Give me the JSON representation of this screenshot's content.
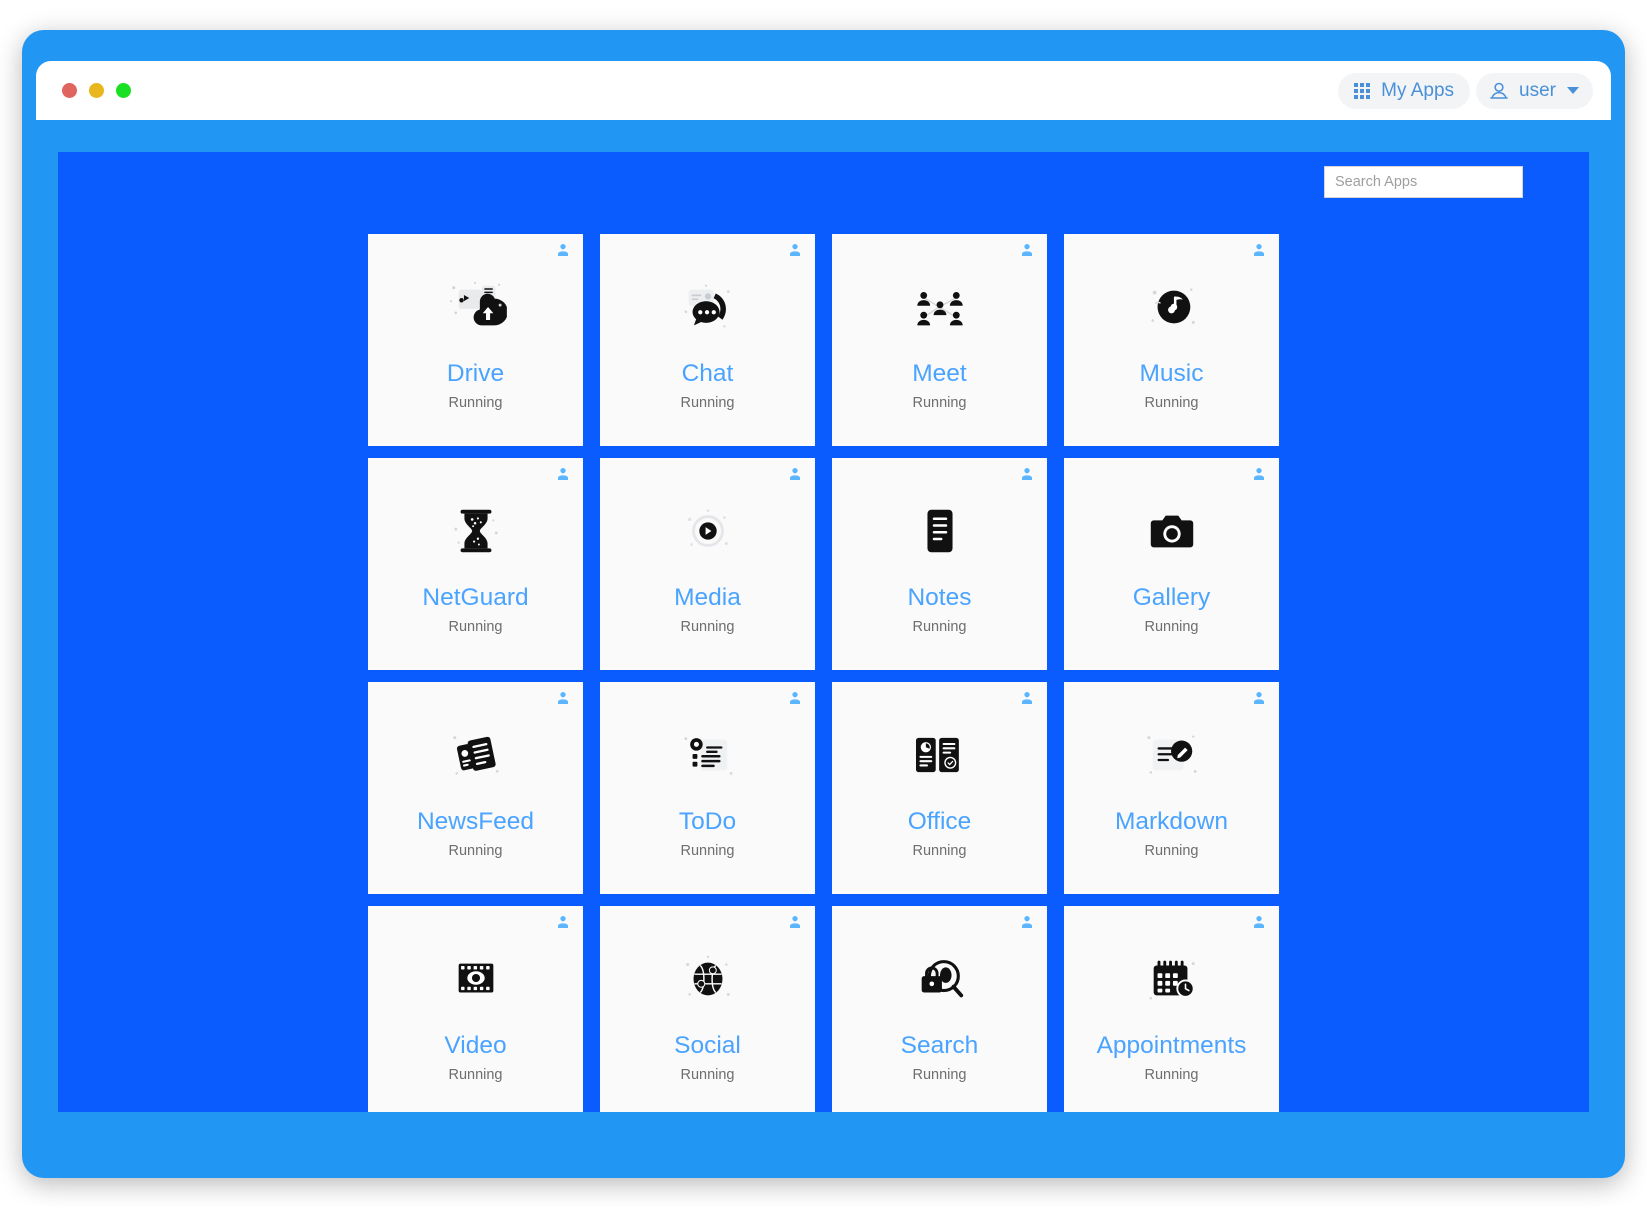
{
  "window": {
    "traffic_lights": [
      "close",
      "minimize",
      "maximize"
    ],
    "colors": {
      "frame": "#2196f3",
      "content_bg": "#0b5cff",
      "card_bg": "#fafafa",
      "accent_text": "#4aa3ff",
      "nav_text": "#4a90d9",
      "status_text": "#6e6e6e",
      "traffic_red": "#e0655f",
      "traffic_yellow": "#e8b61d",
      "traffic_green": "#1ae024"
    }
  },
  "header": {
    "my_apps_label": "My Apps",
    "my_apps_icon": "grid-apps-icon",
    "user_label": "user",
    "user_icon": "person-icon",
    "dropdown_icon": "caret-down-icon"
  },
  "search": {
    "placeholder": "Search Apps",
    "value": ""
  },
  "apps": [
    {
      "name": "Drive",
      "status": "Running",
      "icon": "cloud-upload-icon",
      "badge": "person-badge-icon"
    },
    {
      "name": "Chat",
      "status": "Running",
      "icon": "chat-bubble-icon",
      "badge": "person-badge-icon"
    },
    {
      "name": "Meet",
      "status": "Running",
      "icon": "people-network-icon",
      "badge": "person-badge-icon"
    },
    {
      "name": "Music",
      "status": "Running",
      "icon": "music-note-disc-icon",
      "badge": "person-badge-icon"
    },
    {
      "name": "NetGuard",
      "status": "Running",
      "icon": "hourglass-icon",
      "badge": "person-badge-icon"
    },
    {
      "name": "Media",
      "status": "Running",
      "icon": "play-circle-icon",
      "badge": "person-badge-icon"
    },
    {
      "name": "Notes",
      "status": "Running",
      "icon": "notepad-lines-icon",
      "badge": "person-badge-icon"
    },
    {
      "name": "Gallery",
      "status": "Running",
      "icon": "camera-icon",
      "badge": "person-badge-icon"
    },
    {
      "name": "NewsFeed",
      "status": "Running",
      "icon": "news-pages-icon",
      "badge": "person-badge-icon"
    },
    {
      "name": "ToDo",
      "status": "Running",
      "icon": "checklist-icon",
      "badge": "person-badge-icon"
    },
    {
      "name": "Office",
      "status": "Running",
      "icon": "documents-icon",
      "badge": "person-badge-icon"
    },
    {
      "name": "Markdown",
      "status": "Running",
      "icon": "pencil-document-icon",
      "badge": "person-badge-icon"
    },
    {
      "name": "Video",
      "status": "Running",
      "icon": "film-eye-icon",
      "badge": "person-badge-icon"
    },
    {
      "name": "Social",
      "status": "Running",
      "icon": "globe-people-icon",
      "badge": "person-badge-icon"
    },
    {
      "name": "Search",
      "status": "Running",
      "icon": "lock-magnifier-icon",
      "badge": "person-badge-icon"
    },
    {
      "name": "Appointments",
      "status": "Running",
      "icon": "calendar-clock-icon",
      "badge": "person-badge-icon"
    }
  ]
}
